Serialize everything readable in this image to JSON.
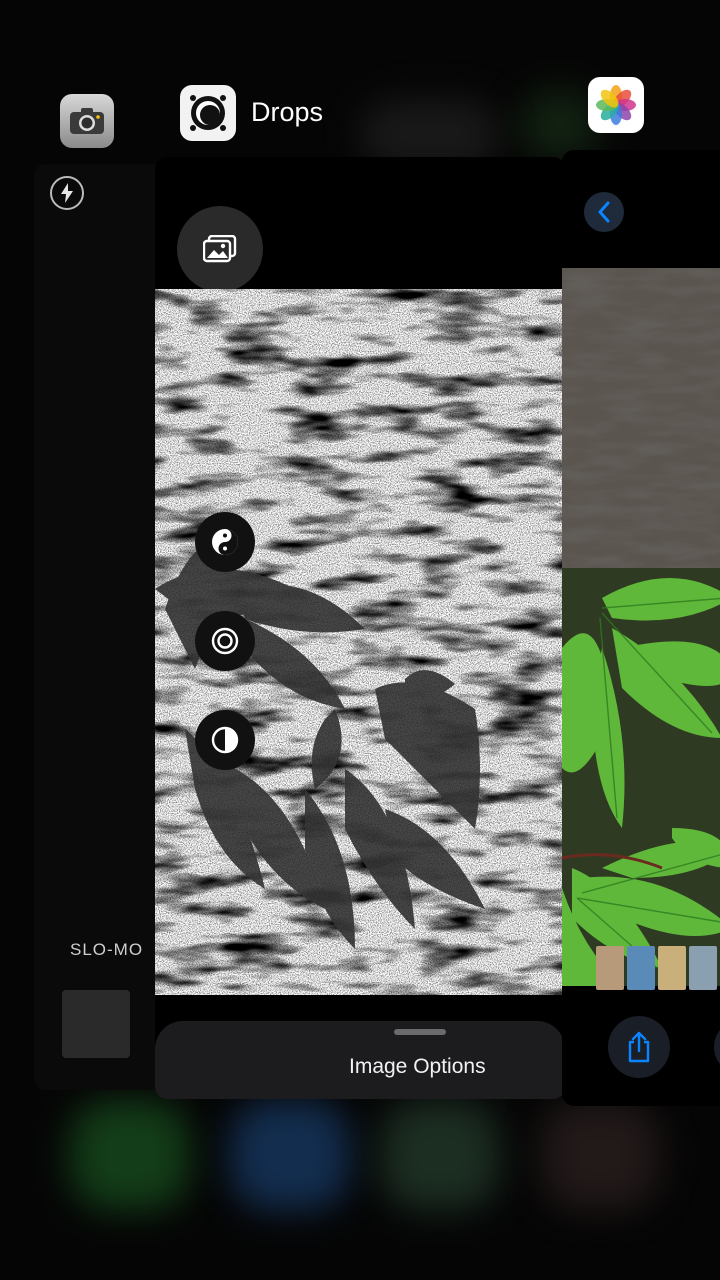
{
  "app_switcher": {
    "apps": [
      {
        "name": "",
        "icon": "camera-app-icon"
      },
      {
        "name": "Drops",
        "icon": "drops-app-icon"
      },
      {
        "name": "",
        "icon": "photos-app-icon"
      }
    ]
  },
  "camera_card": {
    "flash_icon": "flash-icon",
    "mode_label": "SLO-MO"
  },
  "drops_card": {
    "gallery_icon": "gallery-icon",
    "tools": [
      {
        "icon": "yin-yang-icon"
      },
      {
        "icon": "target-icon"
      },
      {
        "icon": "contrast-icon"
      }
    ],
    "sheet_label": "Image Options"
  },
  "photos_card": {
    "back_icon": "chevron-left-icon",
    "share_icon": "share-icon"
  },
  "colors": {
    "background": "#050505",
    "sheet": "#1c1c1e",
    "ios_blue": "#0a84ff",
    "leaf_green": "#3fa02e"
  }
}
